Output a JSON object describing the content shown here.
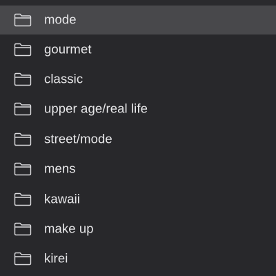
{
  "folders": [
    {
      "label": "mode",
      "icon": "folder-icon",
      "selected": true
    },
    {
      "label": "gourmet",
      "icon": "folder-icon",
      "selected": false
    },
    {
      "label": "classic",
      "icon": "folder-icon",
      "selected": false
    },
    {
      "label": "upper age/real life",
      "icon": "folder-icon",
      "selected": false
    },
    {
      "label": "street/mode",
      "icon": "folder-icon",
      "selected": false
    },
    {
      "label": "mens",
      "icon": "folder-icon",
      "selected": false
    },
    {
      "label": "kawaii",
      "icon": "folder-icon",
      "selected": false
    },
    {
      "label": "make up",
      "icon": "folder-icon",
      "selected": false
    },
    {
      "label": "kirei",
      "icon": "folder-icon",
      "selected": false
    }
  ],
  "colors": {
    "background": "#28282b",
    "selected_row": "#48484b",
    "text": "#e8e8ea",
    "icon_stroke": "#dcdcdf"
  }
}
